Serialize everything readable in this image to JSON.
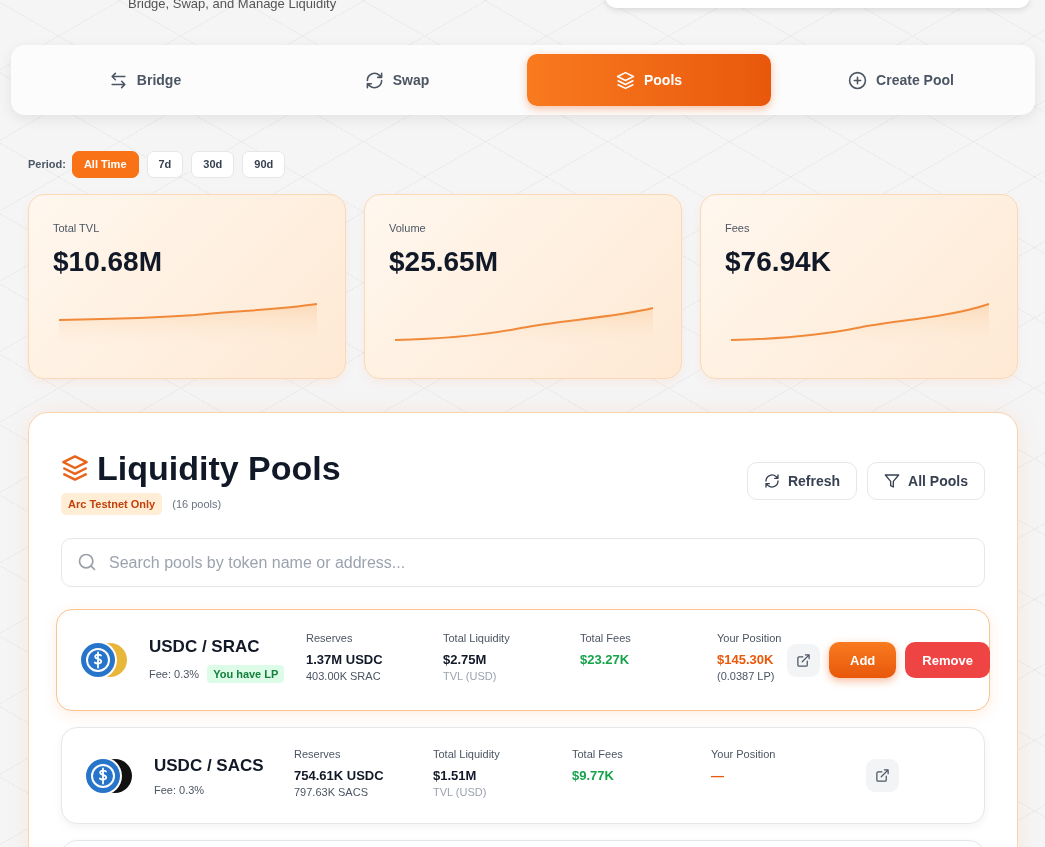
{
  "header": {
    "subtitle": "Bridge, Swap, and Manage Liquidity"
  },
  "tabs": [
    {
      "label": "Bridge",
      "selected": false
    },
    {
      "label": "Swap",
      "selected": false
    },
    {
      "label": "Pools",
      "selected": true
    },
    {
      "label": "Create Pool",
      "selected": false
    }
  ],
  "period": {
    "label": "Period:",
    "options": [
      {
        "label": "All Time",
        "selected": true
      },
      {
        "label": "7d",
        "selected": false
      },
      {
        "label": "30d",
        "selected": false
      },
      {
        "label": "90d",
        "selected": false
      }
    ]
  },
  "stats": [
    {
      "label": "Total TVL",
      "value": "$10.68M"
    },
    {
      "label": "Volume",
      "value": "$25.65M"
    },
    {
      "label": "Fees",
      "value": "$76.94K"
    }
  ],
  "panel": {
    "title": "Liquidity Pools",
    "badge": "Arc Testnet Only",
    "count": "(16 pools)",
    "buttons": [
      {
        "label": "Refresh"
      },
      {
        "label": "All Pools"
      }
    ],
    "search": {
      "placeholder": "Search pools by token name or address..."
    },
    "pools": [
      {
        "name": "USDC / SRAC",
        "fee": "Fee: 0.3%",
        "lp_badge": "You have LP",
        "highlighted": true,
        "color": "#e8b73a",
        "reserves_label": "Reserves",
        "reserve_a": "1.37M USDC",
        "reserve_b": "403.00K SRAC",
        "liquidity_label": "Total Liquidity",
        "liquidity": "$2.75M",
        "liquidity_note": "TVL (USD)",
        "fees_label": "Total Fees",
        "fees": "$23.27K",
        "position_label": "Your Position",
        "position": "$145.30K",
        "position_lp": "(0.0387 LP)",
        "actions": [
          "Add",
          "Remove"
        ]
      },
      {
        "name": "USDC / SACS",
        "fee": "Fee: 0.3%",
        "highlighted": false,
        "color": "#111111",
        "reserves_label": "Reserves",
        "reserve_a": "754.61K USDC",
        "reserve_b": "797.63K SACS",
        "liquidity_label": "Total Liquidity",
        "liquidity": "$1.51M",
        "liquidity_note": "TVL (USD)",
        "fees_label": "Total Fees",
        "fees": "$9.77K",
        "position_label": "Your Position",
        "position": "—"
      }
    ]
  }
}
